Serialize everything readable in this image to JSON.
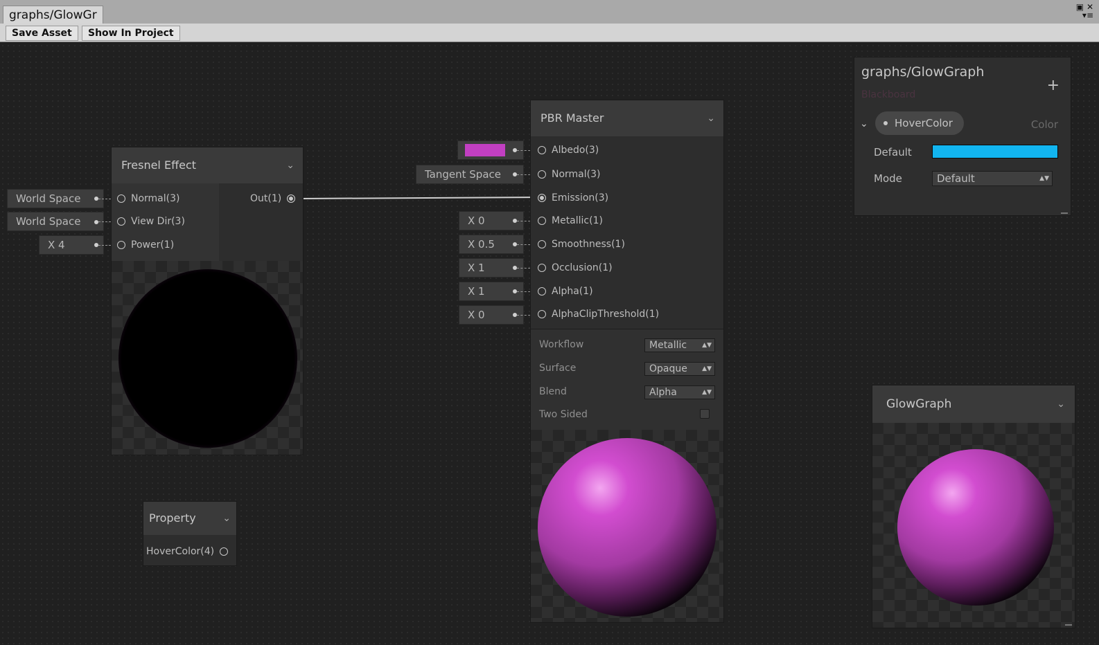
{
  "window": {
    "tab_title": "graphs/GlowGr",
    "toolbar": {
      "save_asset": "Save Asset",
      "show_in_project": "Show In Project"
    }
  },
  "fresnel_node": {
    "title": "Fresnel Effect",
    "inputs": [
      {
        "label": "Normal(3)",
        "value": "World Space"
      },
      {
        "label": "View Dir(3)",
        "value": "World Space"
      },
      {
        "label": "Power(1)",
        "value": "X 4"
      }
    ],
    "output": "Out(1)"
  },
  "pbr_master": {
    "title": "PBR Master",
    "inputs": [
      {
        "label": "Albedo(3)",
        "value": "",
        "swatch": "#c23fc2"
      },
      {
        "label": "Normal(3)",
        "value": "Tangent Space"
      },
      {
        "label": "Emission(3)",
        "value": ""
      },
      {
        "label": "Metallic(1)",
        "value": "X 0"
      },
      {
        "label": "Smoothness(1)",
        "value": "X 0.5"
      },
      {
        "label": "Occlusion(1)",
        "value": "X 1"
      },
      {
        "label": "Alpha(1)",
        "value": "X 1"
      },
      {
        "label": "AlphaClipThreshold(1)",
        "value": "X 0"
      }
    ],
    "settings": {
      "workflow_label": "Workflow",
      "workflow_value": "Metallic",
      "surface_label": "Surface",
      "surface_value": "Opaque",
      "blend_label": "Blend",
      "blend_value": "Alpha",
      "two_sided_label": "Two Sided",
      "two_sided_checked": false
    }
  },
  "property_node": {
    "title": "Property",
    "output": "HoverColor(4)"
  },
  "blackboard": {
    "title": "graphs/GlowGraph",
    "subtitle": "Blackboard",
    "add_icon": "plus-icon",
    "property_name": "HoverColor",
    "property_type": "Color",
    "default_label": "Default",
    "default_color": "#12b5f0",
    "mode_label": "Mode",
    "mode_value": "Default"
  },
  "main_preview": {
    "title": "GlowGraph"
  },
  "colors": {
    "accent_magenta": "#c23fc2",
    "property_blue": "#12b5f0",
    "canvas_bg": "#202020"
  }
}
